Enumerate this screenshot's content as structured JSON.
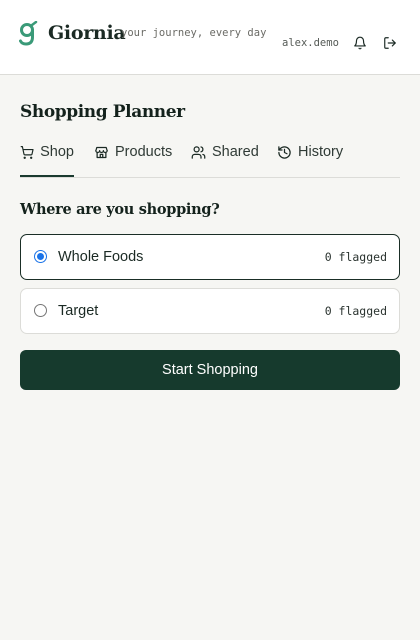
{
  "header": {
    "brand": "Giornia",
    "tagline": "your journey, every day",
    "username": "alex.demo",
    "accent": "#3a9a78"
  },
  "page": {
    "title": "Shopping Planner"
  },
  "tabs": [
    {
      "label": "Shop",
      "icon": "cart-icon",
      "active": true
    },
    {
      "label": "Products",
      "icon": "store-icon",
      "active": false
    },
    {
      "label": "Shared",
      "icon": "users-icon",
      "active": false
    },
    {
      "label": "History",
      "icon": "history-icon",
      "active": false
    }
  ],
  "shopping": {
    "question": "Where are you shopping?",
    "stores": [
      {
        "name": "Whole Foods",
        "flagged": "0 flagged",
        "selected": true
      },
      {
        "name": "Target",
        "flagged": "0 flagged",
        "selected": false
      }
    ],
    "start_label": "Start Shopping"
  },
  "colors": {
    "primary": "#163a2d",
    "background": "#f6f6f3",
    "radio": "#1a73e8"
  }
}
